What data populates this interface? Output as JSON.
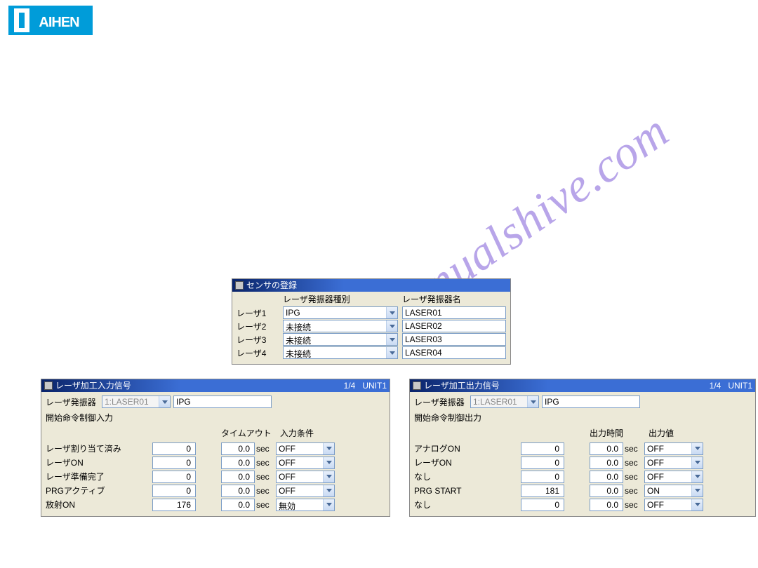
{
  "brand": "DAIHEN",
  "watermark": "manualshive.com",
  "sensor_panel": {
    "title": "センサの登録",
    "header_type": "レーザ発振器種別",
    "header_name": "レーザ発振器名",
    "rows": [
      {
        "label": "レーザ1",
        "type": "IPG",
        "name": "LASER01"
      },
      {
        "label": "レーザ2",
        "type": "未接続",
        "name": "LASER02"
      },
      {
        "label": "レーザ3",
        "type": "未接続",
        "name": "LASER03"
      },
      {
        "label": "レーザ4",
        "type": "未接続",
        "name": "LASER04"
      }
    ]
  },
  "input_panel": {
    "title": "レーザ加工入力信号",
    "page": "1/4",
    "unit": "UNIT1",
    "osc_label": "レーザ発振器",
    "osc_sel": "1:LASER01",
    "osc_name": "IPG",
    "subtitle": "開始命令制御入力",
    "col_a": "",
    "col_b": "タイムアウト",
    "col_c": "入力条件",
    "sec": "sec",
    "rows": [
      {
        "label": "レーザ割り当て済み",
        "a": "0",
        "b": "0.0",
        "c": "OFF"
      },
      {
        "label": "レーザON",
        "a": "0",
        "b": "0.0",
        "c": "OFF"
      },
      {
        "label": "レーザ準備完了",
        "a": "0",
        "b": "0.0",
        "c": "OFF"
      },
      {
        "label": "PRGアクティブ",
        "a": "0",
        "b": "0.0",
        "c": "OFF"
      },
      {
        "label": "放射ON",
        "a": "176",
        "b": "0.0",
        "c": "無効"
      }
    ]
  },
  "output_panel": {
    "title": "レーザ加工出力信号",
    "page": "1/4",
    "unit": "UNIT1",
    "osc_label": "レーザ発振器",
    "osc_sel": "1:LASER01",
    "osc_name": "IPG",
    "subtitle": "開始命令制御出力",
    "col_a": "",
    "col_b": "出力時間",
    "col_c": "出力値",
    "sec": "sec",
    "rows": [
      {
        "label": "アナログON",
        "a": "0",
        "b": "0.0",
        "c": "OFF"
      },
      {
        "label": "レーザON",
        "a": "0",
        "b": "0.0",
        "c": "OFF"
      },
      {
        "label": "なし",
        "a": "0",
        "b": "0.0",
        "c": "OFF"
      },
      {
        "label": "PRG START",
        "a": "181",
        "b": "0.0",
        "c": "ON"
      },
      {
        "label": "なし",
        "a": "0",
        "b": "0.0",
        "c": "OFF"
      }
    ]
  }
}
